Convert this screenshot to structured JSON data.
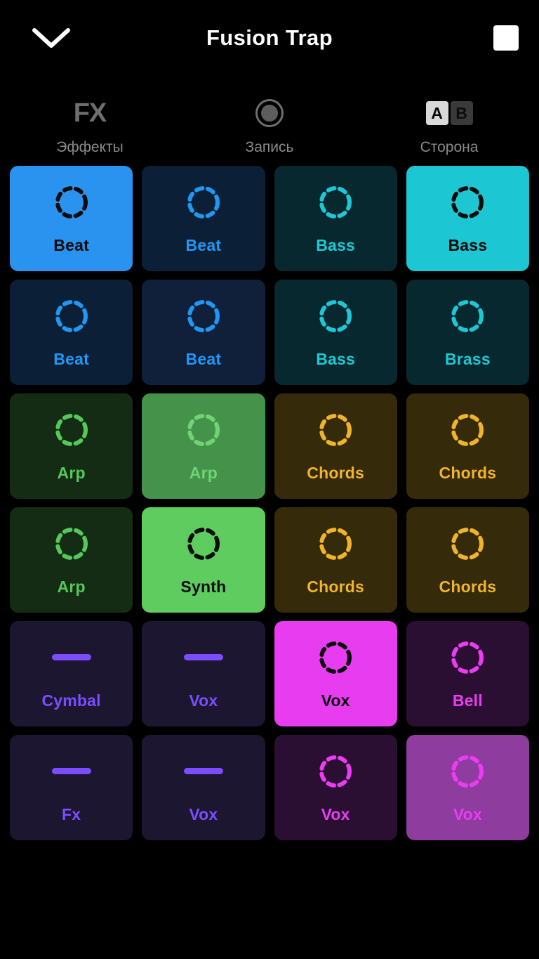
{
  "header": {
    "collapse_icon": "chevron-down-icon",
    "title": "Fusion Trap",
    "stop_icon": "stop-square-icon"
  },
  "toolbar": {
    "items": [
      {
        "glyph": "FX",
        "icon_name": "fx-icon",
        "label": "Эффекты"
      },
      {
        "glyph": "",
        "icon_name": "record-icon",
        "label": "Запись"
      },
      {
        "glyph": "",
        "icon_name": "ab-side-toggle",
        "label": "Сторона",
        "a_label": "A",
        "b_label": "B",
        "selected": "A"
      }
    ]
  },
  "colors": {
    "blue_accent": "#2196f3",
    "blue_bg": "#0b2036",
    "blue_active_bg": "#2a93f0",
    "cyan_accent": "#1dc8d4",
    "cyan_bg": "#08282f",
    "cyan_active_bg": "#1cc6d2",
    "green_accent": "#55c85a",
    "green_bg": "#152c14",
    "green_active_bg": "#5ecc5e",
    "green_pending_bg": "#45934a",
    "amber_accent": "#f0b429",
    "amber_bg": "#352a0a",
    "violet_accent": "#7a4dff",
    "violet_bg": "#1c1630",
    "magenta_accent": "#ea3cf2",
    "magenta_bg": "#2b0f33",
    "magenta_active_bg": "#e83cf0",
    "magenta_pending_bg": "#8e3c9e",
    "active_ink": "#0b0b0b",
    "screen_bg": "#000000"
  },
  "pad_grid": {
    "columns": 4,
    "rows": 6,
    "pads": [
      {
        "label": "Beat",
        "icon": "dashed-circle-icon",
        "state": "active",
        "bg": "#2a93f0",
        "ink": "#0b0b0b"
      },
      {
        "label": "Beat",
        "icon": "dashed-circle-icon",
        "state": "idle",
        "bg": "#0b2036",
        "ink": "#2196f3"
      },
      {
        "label": "Bass",
        "icon": "dashed-circle-icon",
        "state": "idle",
        "bg": "#08282f",
        "ink": "#1dc8d4"
      },
      {
        "label": "Bass",
        "icon": "dashed-circle-icon",
        "state": "active",
        "bg": "#1cc6d2",
        "ink": "#0b0b0b"
      },
      {
        "label": "Beat",
        "icon": "dashed-circle-icon",
        "state": "idle",
        "bg": "#0b2036",
        "ink": "#2196f3"
      },
      {
        "label": "Beat",
        "icon": "dashed-circle-icon",
        "state": "idle",
        "bg": "#10203a",
        "ink": "#2196f3"
      },
      {
        "label": "Bass",
        "icon": "dashed-circle-icon",
        "state": "idle",
        "bg": "#08282f",
        "ink": "#1dc8d4"
      },
      {
        "label": "Brass",
        "icon": "dashed-circle-icon",
        "state": "idle",
        "bg": "#08282f",
        "ink": "#1dc8d4"
      },
      {
        "label": "Arp",
        "icon": "dashed-circle-icon",
        "state": "idle",
        "bg": "#152c14",
        "ink": "#55c85a"
      },
      {
        "label": "Arp",
        "icon": "dashed-circle-icon",
        "state": "pending",
        "bg": "#45934a",
        "ink": "#6fd472"
      },
      {
        "label": "Chords",
        "icon": "dashed-circle-icon",
        "state": "idle",
        "bg": "#352a0a",
        "ink": "#f0b429"
      },
      {
        "label": "Chords",
        "icon": "dashed-circle-icon",
        "state": "idle",
        "bg": "#352a0a",
        "ink": "#f0b429"
      },
      {
        "label": "Arp",
        "icon": "dashed-circle-icon",
        "state": "idle",
        "bg": "#152c14",
        "ink": "#55c85a"
      },
      {
        "label": "Synth",
        "icon": "dashed-circle-icon",
        "state": "active",
        "bg": "#5ecc5e",
        "ink": "#0b0b0b"
      },
      {
        "label": "Chords",
        "icon": "dashed-circle-icon",
        "state": "idle",
        "bg": "#352a0a",
        "ink": "#f0b429"
      },
      {
        "label": "Chords",
        "icon": "dashed-circle-icon",
        "state": "idle",
        "bg": "#352a0a",
        "ink": "#f0b429"
      },
      {
        "label": "Cymbal",
        "icon": "dash-bar-icon",
        "state": "idle",
        "bg": "#1c1630",
        "ink": "#7a4dff"
      },
      {
        "label": "Vox",
        "icon": "dash-bar-icon",
        "state": "idle",
        "bg": "#1c1630",
        "ink": "#7a4dff"
      },
      {
        "label": "Vox",
        "icon": "dashed-circle-icon",
        "state": "active",
        "bg": "#e83cf0",
        "ink": "#0b0b0b"
      },
      {
        "label": "Bell",
        "icon": "dashed-circle-icon",
        "state": "idle",
        "bg": "#2b0f33",
        "ink": "#ea3cf2"
      },
      {
        "label": "Fx",
        "icon": "dash-bar-icon",
        "state": "idle",
        "bg": "#1c1630",
        "ink": "#7a4dff"
      },
      {
        "label": "Vox",
        "icon": "dash-bar-icon",
        "state": "idle",
        "bg": "#1c1630",
        "ink": "#7a4dff"
      },
      {
        "label": "Vox",
        "icon": "dashed-circle-icon",
        "state": "idle",
        "bg": "#2b0f33",
        "ink": "#ea3cf2"
      },
      {
        "label": "Vox",
        "icon": "dashed-circle-icon",
        "state": "pending",
        "bg": "#8e3c9e",
        "ink": "#ea3cf2"
      }
    ]
  }
}
